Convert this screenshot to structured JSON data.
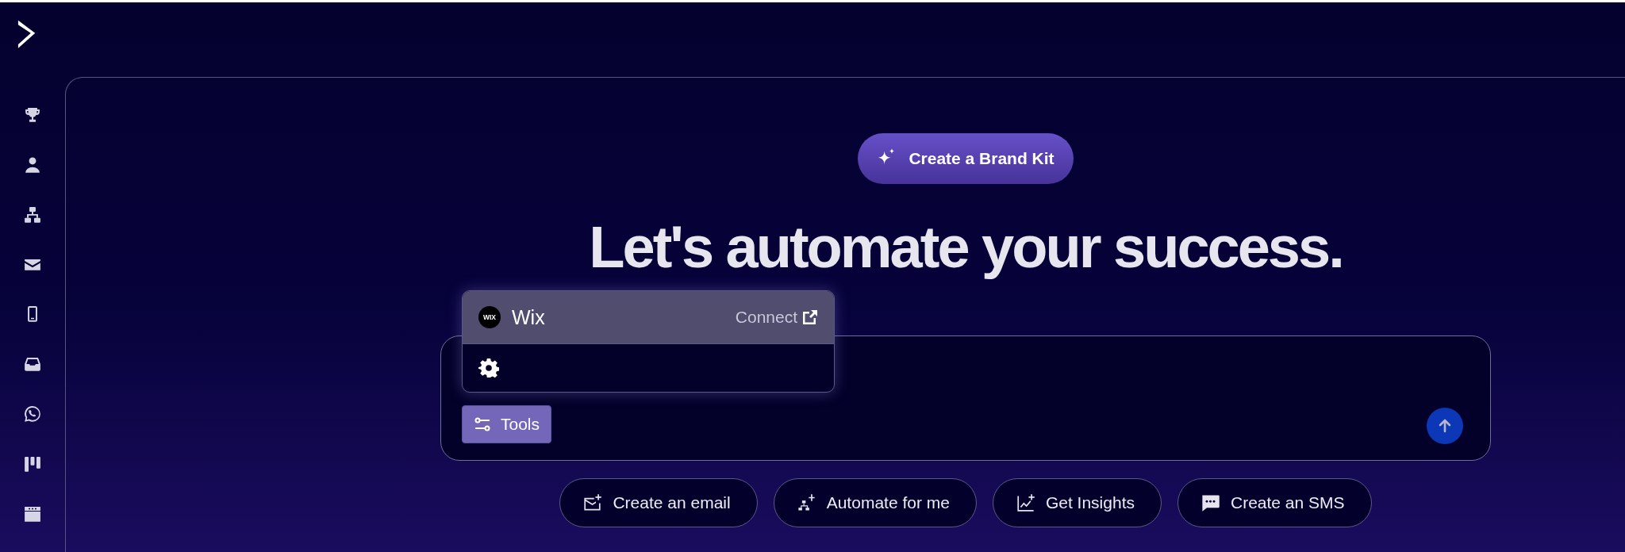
{
  "brand_button": {
    "label": "Create a Brand Kit"
  },
  "heading": "Let's automate your success.",
  "tools_menu": {
    "items": [
      {
        "kind": "integration",
        "logo_text": "WIX",
        "name": "Wix",
        "action": "Connect",
        "selected": true
      },
      {
        "kind": "settings",
        "selected": false
      }
    ]
  },
  "tools_button": {
    "label": "Tools"
  },
  "suggestions": [
    {
      "label": "Create an email"
    },
    {
      "label": "Automate for me"
    },
    {
      "label": "Get Insights"
    },
    {
      "label": "Create an SMS"
    }
  ]
}
